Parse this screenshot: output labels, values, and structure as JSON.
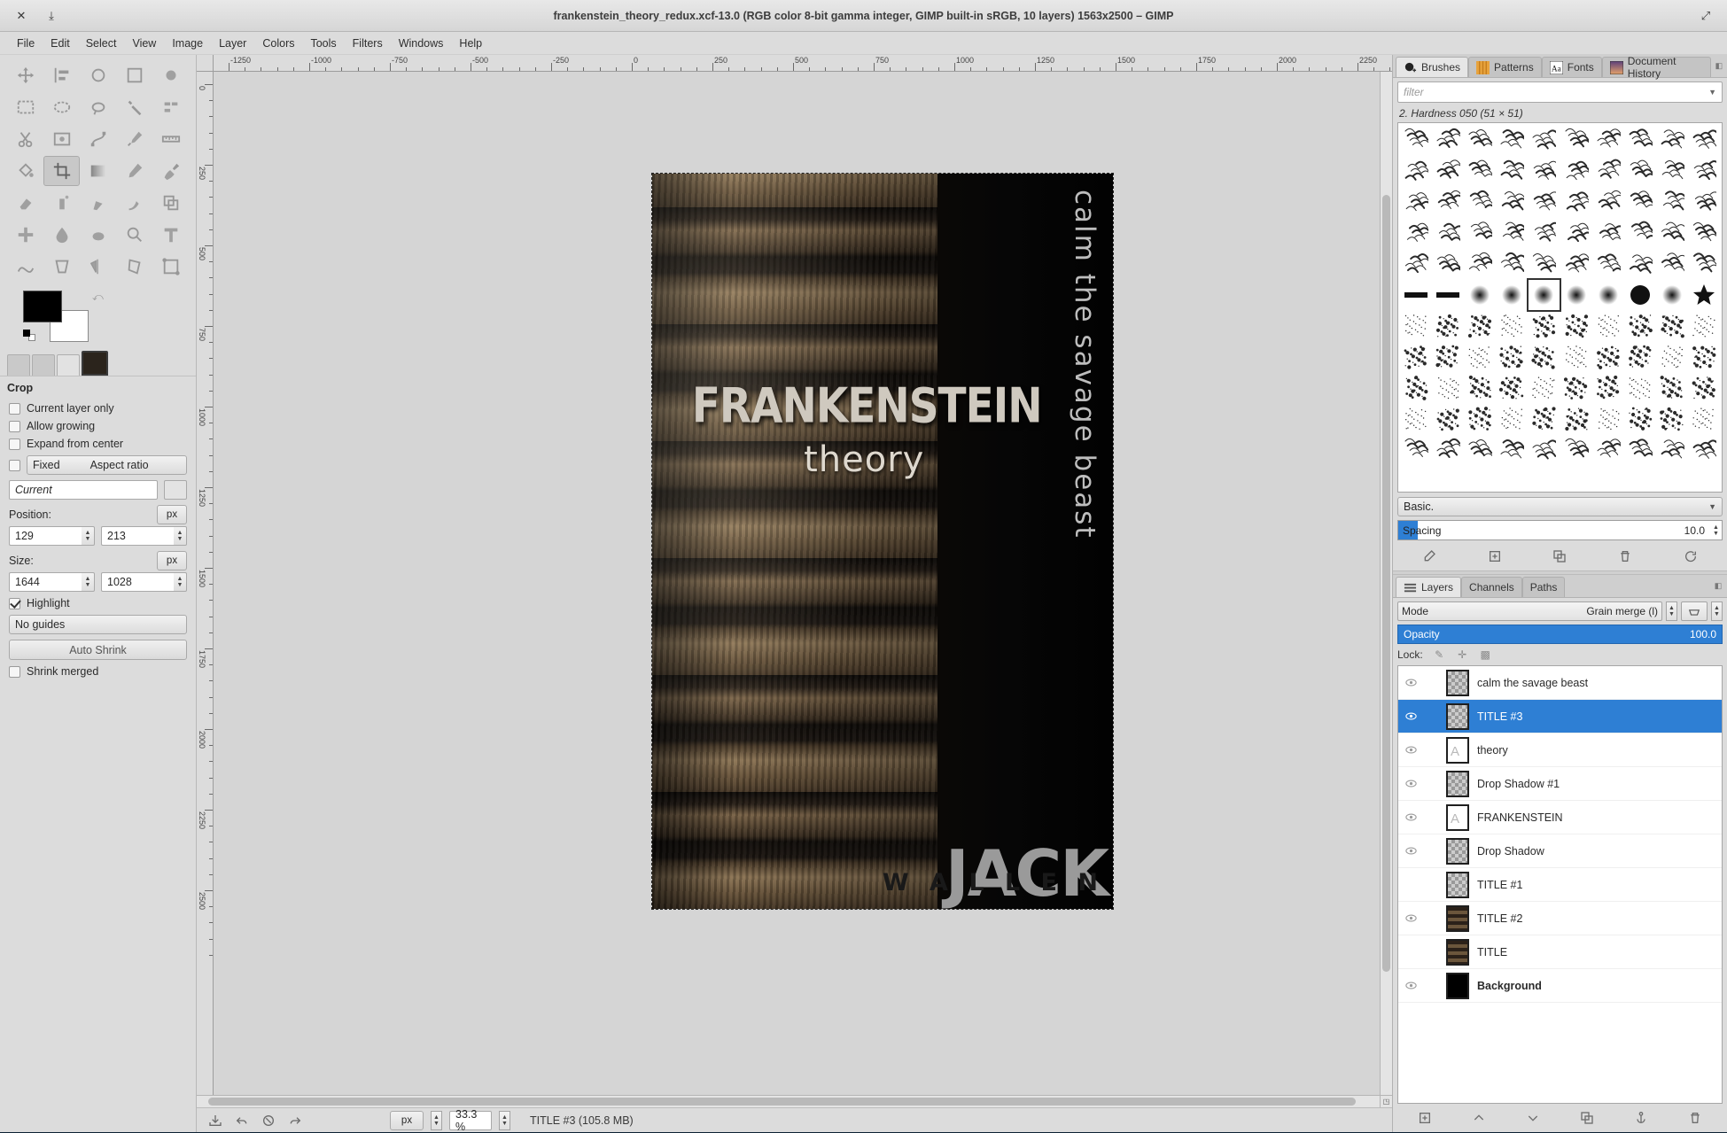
{
  "window": {
    "title": "frankenstein_theory_redux.xcf-13.0 (RGB color 8-bit gamma integer, GIMP built-in sRGB, 10 layers) 1563x2500 – GIMP",
    "close_icon": "✕",
    "minimize_icon": "⤓",
    "maximize_icon": "⤢"
  },
  "menubar": {
    "items": [
      "File",
      "Edit",
      "Select",
      "View",
      "Image",
      "Layer",
      "Colors",
      "Tools",
      "Filters",
      "Windows",
      "Help"
    ]
  },
  "toolbox": {
    "tools": [
      {
        "name": "move-tool"
      },
      {
        "name": "alignment-tool"
      },
      {
        "name": "crop-tool"
      },
      {
        "name": "unified-transform-tool"
      },
      {
        "name": "rotate-tool"
      },
      {
        "name": "rectangle-select-tool"
      },
      {
        "name": "ellipse-select-tool"
      },
      {
        "name": "free-select-tool"
      },
      {
        "name": "fuzzy-select-tool"
      },
      {
        "name": "by-color-select-tool"
      },
      {
        "name": "scissors-select-tool"
      },
      {
        "name": "foreground-select-tool"
      },
      {
        "name": "paths-tool"
      },
      {
        "name": "color-picker-tool"
      },
      {
        "name": "measure-tool"
      },
      {
        "name": "bucket-fill-tool"
      },
      {
        "name": "gradient-tool"
      },
      {
        "name": "pencil-tool"
      },
      {
        "name": "paintbrush-tool"
      },
      {
        "name": "eraser-tool"
      },
      {
        "name": "airbrush-tool"
      },
      {
        "name": "ink-tool"
      },
      {
        "name": "mypaint-brush-tool"
      },
      {
        "name": "clone-tool"
      },
      {
        "name": "heal-tool"
      },
      {
        "name": "blur-sharpen-tool"
      },
      {
        "name": "smudge-tool"
      },
      {
        "name": "dodge-burn-tool"
      },
      {
        "name": "text-tool"
      },
      {
        "name": "warp-transform-tool"
      }
    ],
    "selected": "crop-tool",
    "colors": {
      "foreground": "#000000",
      "background": "#ffffff"
    }
  },
  "tool_options": {
    "title": "Crop",
    "checkboxes": [
      {
        "label": "Current layer only",
        "checked": false
      },
      {
        "label": "Allow growing",
        "checked": false
      },
      {
        "label": "Expand from center",
        "checked": false
      }
    ],
    "fixed": {
      "checked": false,
      "button_label": "Fixed",
      "mode_label": "Aspect ratio"
    },
    "ratio_value": "Current",
    "position": {
      "label": "Position:",
      "unit": "px",
      "x": "129",
      "y": "213"
    },
    "size": {
      "label": "Size:",
      "unit": "px",
      "w": "1644",
      "h": "1028"
    },
    "highlight": {
      "label": "Highlight",
      "checked": true
    },
    "guides": "No guides",
    "auto_shrink": "Auto Shrink",
    "shrink_merged": {
      "label": "Shrink merged",
      "checked": false
    }
  },
  "canvas": {
    "ruler_top_labels": [
      "-1250",
      "-1000",
      "-750",
      "-500",
      "-250",
      "0",
      "250",
      "500",
      "750",
      "1000",
      "1250",
      "1500",
      "1750",
      "2000",
      "2250"
    ],
    "ruler_left_labels": [
      "0",
      "250",
      "500",
      "750",
      "1000",
      "1250",
      "1500",
      "1750",
      "2000",
      "2250",
      "2500"
    ],
    "poster": {
      "title": "FRANKENSTEIN",
      "subtitle": "theory",
      "vertical_tagline": "calm the savage beast",
      "author_first": "JACK",
      "author_last": "W A L L E N"
    }
  },
  "statusbar": {
    "unit": "px",
    "zoom": "33.3 %",
    "text": "TITLE #3 (105.8 MB)",
    "icons": [
      "save-icon",
      "undo-icon",
      "cancel-icon",
      "redo-icon"
    ]
  },
  "brushes_dock": {
    "tabs": [
      {
        "label": "Brushes",
        "icon": "brush-icon",
        "active": true
      },
      {
        "label": "Patterns",
        "icon": "pattern-icon",
        "active": false
      },
      {
        "label": "Fonts",
        "icon": "font-icon",
        "active": false
      },
      {
        "label": "Document History",
        "icon": "history-icon",
        "active": false
      }
    ],
    "filter_placeholder": "filter",
    "selected_brush": "2. Hardness 050 (51 × 51)",
    "brush_set": "Basic.",
    "spacing": {
      "label": "Spacing",
      "value": "10.0"
    },
    "buttons": [
      "edit-brush-icon",
      "new-brush-icon",
      "duplicate-brush-icon",
      "delete-brush-icon",
      "refresh-brushes-icon"
    ]
  },
  "layers_dock": {
    "tabs": [
      {
        "label": "Layers",
        "icon": "layers-icon",
        "active": true
      },
      {
        "label": "Channels",
        "icon": "channels-icon",
        "active": false
      },
      {
        "label": "Paths",
        "icon": "paths-icon",
        "active": false
      }
    ],
    "mode": {
      "label": "Mode",
      "value": "Grain merge (l)"
    },
    "opacity": {
      "label": "Opacity",
      "value": "100.0"
    },
    "lock": {
      "label": "Lock:",
      "icons": [
        "lock-pixels-icon",
        "lock-position-icon",
        "lock-alpha-icon"
      ]
    },
    "layers": [
      {
        "name": "calm the savage beast",
        "visible": true,
        "selected": false,
        "thumb": "checker"
      },
      {
        "name": "TITLE #3",
        "visible": true,
        "selected": true,
        "thumb": "checker"
      },
      {
        "name": "theory",
        "visible": true,
        "selected": false,
        "thumb": "white"
      },
      {
        "name": "Drop Shadow #1",
        "visible": true,
        "selected": false,
        "thumb": "checker"
      },
      {
        "name": "FRANKENSTEIN",
        "visible": true,
        "selected": false,
        "thumb": "white"
      },
      {
        "name": "Drop Shadow",
        "visible": true,
        "selected": false,
        "thumb": "checker"
      },
      {
        "name": "TITLE #1",
        "visible": false,
        "selected": false,
        "thumb": "checker"
      },
      {
        "name": "TITLE #2",
        "visible": true,
        "selected": false,
        "thumb": "wood"
      },
      {
        "name": "TITLE",
        "visible": false,
        "selected": false,
        "thumb": "wood"
      },
      {
        "name": "Background",
        "visible": true,
        "selected": false,
        "thumb": "black",
        "bold": true
      }
    ],
    "buttons": [
      "new-layer-icon",
      "raise-layer-icon",
      "lower-layer-icon",
      "duplicate-layer-icon",
      "anchor-layer-icon",
      "delete-layer-icon"
    ]
  },
  "colors": {
    "accent": "#2e7fd4",
    "panel": "#dcdcdc",
    "canvas_bg": "#d5d5d5"
  }
}
